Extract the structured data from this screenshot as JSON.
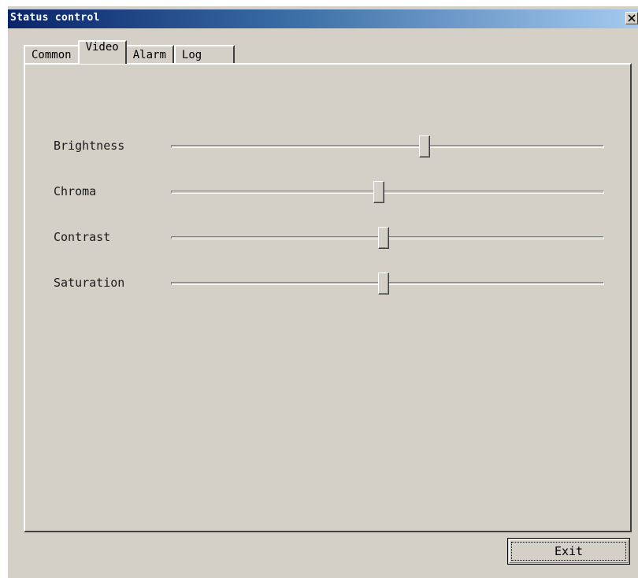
{
  "window": {
    "title": "Status control",
    "close_glyph": "✕"
  },
  "tabs": [
    {
      "label": "Common",
      "active": false
    },
    {
      "label": "Video",
      "active": true
    },
    {
      "label": "Alarm",
      "active": false
    },
    {
      "label": "Log",
      "active": false
    }
  ],
  "sliders": [
    {
      "label": "Brightness",
      "value": 0.585
    },
    {
      "label": "Chroma",
      "value": 0.48
    },
    {
      "label": "Contrast",
      "value": 0.49
    },
    {
      "label": "Saturation",
      "value": 0.49
    }
  ],
  "footer": {
    "exit_label": "Exit"
  },
  "icons": {
    "close": "close-icon"
  }
}
